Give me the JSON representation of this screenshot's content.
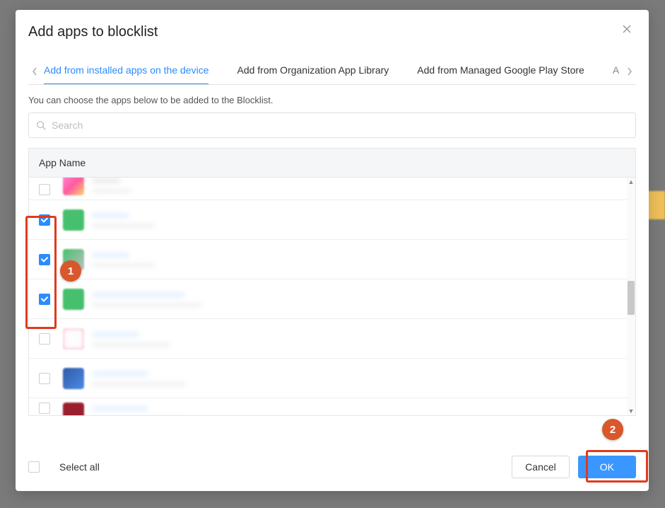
{
  "modal": {
    "title": "Add apps to blocklist",
    "description": "You can choose the apps below to be added to the Blocklist."
  },
  "tabs": {
    "items": [
      {
        "label": "Add from installed apps on the device",
        "active": true
      },
      {
        "label": "Add from Organization App Library",
        "active": false
      },
      {
        "label": "Add from Managed Google Play Store",
        "active": false
      }
    ],
    "peek": "A"
  },
  "search": {
    "placeholder": "Search"
  },
  "list": {
    "header": "App Name",
    "rows": [
      {
        "checked": false,
        "iconClass": "ic-pink",
        "name": "———",
        "sub": "—————",
        "nameDark": true
      },
      {
        "checked": true,
        "iconClass": "ic-green",
        "name": "————",
        "sub": "————————"
      },
      {
        "checked": true,
        "iconClass": "ic-blurgr",
        "name": "————",
        "sub": "————————"
      },
      {
        "checked": true,
        "iconClass": "ic-green",
        "name": "——————————",
        "sub": "——————————————"
      },
      {
        "checked": false,
        "iconClass": "ic-white",
        "name": "—————",
        "sub": "——————————"
      },
      {
        "checked": false,
        "iconClass": "ic-blue",
        "name": "——————",
        "sub": "————————————"
      },
      {
        "checked": false,
        "iconClass": "ic-red",
        "name": "——————",
        "sub": "————————————"
      }
    ]
  },
  "footer": {
    "selectAll": "Select all",
    "cancel": "Cancel",
    "ok": "OK"
  },
  "anno": {
    "one": "1",
    "two": "2"
  }
}
